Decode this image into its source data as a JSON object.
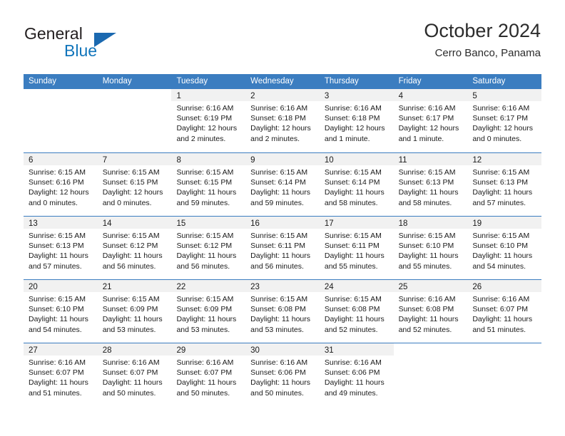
{
  "brand": {
    "name_part1": "General",
    "name_part2": "Blue",
    "triangle_icon": "triangle-icon",
    "accent_color": "#1175bb"
  },
  "header": {
    "title": "October 2024",
    "subtitle": "Cerro Banco, Panama"
  },
  "calendar": {
    "header_color": "#3b7dc0",
    "daynum_bar_color": "#f1f1f1",
    "weekdays": [
      "Sunday",
      "Monday",
      "Tuesday",
      "Wednesday",
      "Thursday",
      "Friday",
      "Saturday"
    ],
    "weeks": [
      [
        {
          "day": "",
          "lines": []
        },
        {
          "day": "",
          "lines": []
        },
        {
          "day": "1",
          "lines": [
            "Sunrise: 6:16 AM",
            "Sunset: 6:19 PM",
            "Daylight: 12 hours",
            "and 2 minutes."
          ]
        },
        {
          "day": "2",
          "lines": [
            "Sunrise: 6:16 AM",
            "Sunset: 6:18 PM",
            "Daylight: 12 hours",
            "and 2 minutes."
          ]
        },
        {
          "day": "3",
          "lines": [
            "Sunrise: 6:16 AM",
            "Sunset: 6:18 PM",
            "Daylight: 12 hours",
            "and 1 minute."
          ]
        },
        {
          "day": "4",
          "lines": [
            "Sunrise: 6:16 AM",
            "Sunset: 6:17 PM",
            "Daylight: 12 hours",
            "and 1 minute."
          ]
        },
        {
          "day": "5",
          "lines": [
            "Sunrise: 6:16 AM",
            "Sunset: 6:17 PM",
            "Daylight: 12 hours",
            "and 0 minutes."
          ]
        }
      ],
      [
        {
          "day": "6",
          "lines": [
            "Sunrise: 6:15 AM",
            "Sunset: 6:16 PM",
            "Daylight: 12 hours",
            "and 0 minutes."
          ]
        },
        {
          "day": "7",
          "lines": [
            "Sunrise: 6:15 AM",
            "Sunset: 6:15 PM",
            "Daylight: 12 hours",
            "and 0 minutes."
          ]
        },
        {
          "day": "8",
          "lines": [
            "Sunrise: 6:15 AM",
            "Sunset: 6:15 PM",
            "Daylight: 11 hours",
            "and 59 minutes."
          ]
        },
        {
          "day": "9",
          "lines": [
            "Sunrise: 6:15 AM",
            "Sunset: 6:14 PM",
            "Daylight: 11 hours",
            "and 59 minutes."
          ]
        },
        {
          "day": "10",
          "lines": [
            "Sunrise: 6:15 AM",
            "Sunset: 6:14 PM",
            "Daylight: 11 hours",
            "and 58 minutes."
          ]
        },
        {
          "day": "11",
          "lines": [
            "Sunrise: 6:15 AM",
            "Sunset: 6:13 PM",
            "Daylight: 11 hours",
            "and 58 minutes."
          ]
        },
        {
          "day": "12",
          "lines": [
            "Sunrise: 6:15 AM",
            "Sunset: 6:13 PM",
            "Daylight: 11 hours",
            "and 57 minutes."
          ]
        }
      ],
      [
        {
          "day": "13",
          "lines": [
            "Sunrise: 6:15 AM",
            "Sunset: 6:13 PM",
            "Daylight: 11 hours",
            "and 57 minutes."
          ]
        },
        {
          "day": "14",
          "lines": [
            "Sunrise: 6:15 AM",
            "Sunset: 6:12 PM",
            "Daylight: 11 hours",
            "and 56 minutes."
          ]
        },
        {
          "day": "15",
          "lines": [
            "Sunrise: 6:15 AM",
            "Sunset: 6:12 PM",
            "Daylight: 11 hours",
            "and 56 minutes."
          ]
        },
        {
          "day": "16",
          "lines": [
            "Sunrise: 6:15 AM",
            "Sunset: 6:11 PM",
            "Daylight: 11 hours",
            "and 56 minutes."
          ]
        },
        {
          "day": "17",
          "lines": [
            "Sunrise: 6:15 AM",
            "Sunset: 6:11 PM",
            "Daylight: 11 hours",
            "and 55 minutes."
          ]
        },
        {
          "day": "18",
          "lines": [
            "Sunrise: 6:15 AM",
            "Sunset: 6:10 PM",
            "Daylight: 11 hours",
            "and 55 minutes."
          ]
        },
        {
          "day": "19",
          "lines": [
            "Sunrise: 6:15 AM",
            "Sunset: 6:10 PM",
            "Daylight: 11 hours",
            "and 54 minutes."
          ]
        }
      ],
      [
        {
          "day": "20",
          "lines": [
            "Sunrise: 6:15 AM",
            "Sunset: 6:10 PM",
            "Daylight: 11 hours",
            "and 54 minutes."
          ]
        },
        {
          "day": "21",
          "lines": [
            "Sunrise: 6:15 AM",
            "Sunset: 6:09 PM",
            "Daylight: 11 hours",
            "and 53 minutes."
          ]
        },
        {
          "day": "22",
          "lines": [
            "Sunrise: 6:15 AM",
            "Sunset: 6:09 PM",
            "Daylight: 11 hours",
            "and 53 minutes."
          ]
        },
        {
          "day": "23",
          "lines": [
            "Sunrise: 6:15 AM",
            "Sunset: 6:08 PM",
            "Daylight: 11 hours",
            "and 53 minutes."
          ]
        },
        {
          "day": "24",
          "lines": [
            "Sunrise: 6:15 AM",
            "Sunset: 6:08 PM",
            "Daylight: 11 hours",
            "and 52 minutes."
          ]
        },
        {
          "day": "25",
          "lines": [
            "Sunrise: 6:16 AM",
            "Sunset: 6:08 PM",
            "Daylight: 11 hours",
            "and 52 minutes."
          ]
        },
        {
          "day": "26",
          "lines": [
            "Sunrise: 6:16 AM",
            "Sunset: 6:07 PM",
            "Daylight: 11 hours",
            "and 51 minutes."
          ]
        }
      ],
      [
        {
          "day": "27",
          "lines": [
            "Sunrise: 6:16 AM",
            "Sunset: 6:07 PM",
            "Daylight: 11 hours",
            "and 51 minutes."
          ]
        },
        {
          "day": "28",
          "lines": [
            "Sunrise: 6:16 AM",
            "Sunset: 6:07 PM",
            "Daylight: 11 hours",
            "and 50 minutes."
          ]
        },
        {
          "day": "29",
          "lines": [
            "Sunrise: 6:16 AM",
            "Sunset: 6:07 PM",
            "Daylight: 11 hours",
            "and 50 minutes."
          ]
        },
        {
          "day": "30",
          "lines": [
            "Sunrise: 6:16 AM",
            "Sunset: 6:06 PM",
            "Daylight: 11 hours",
            "and 50 minutes."
          ]
        },
        {
          "day": "31",
          "lines": [
            "Sunrise: 6:16 AM",
            "Sunset: 6:06 PM",
            "Daylight: 11 hours",
            "and 49 minutes."
          ]
        },
        {
          "day": "",
          "lines": []
        },
        {
          "day": "",
          "lines": []
        }
      ]
    ]
  }
}
